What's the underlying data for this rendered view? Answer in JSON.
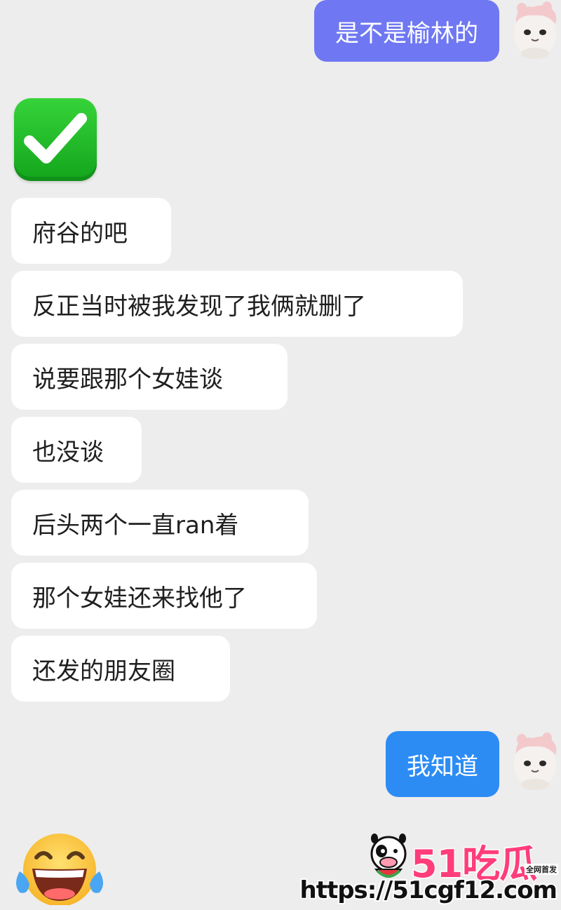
{
  "messages": [
    {
      "id": "m1",
      "sender": "self",
      "text": "是不是榆林的",
      "style": "purple"
    },
    {
      "id": "m2",
      "sender": "other",
      "emoji": "check-mark-emoji"
    },
    {
      "id": "m3",
      "sender": "other",
      "text": "府谷的吧"
    },
    {
      "id": "m4",
      "sender": "other",
      "text": "反正当时被我发现了我俩就删了"
    },
    {
      "id": "m5",
      "sender": "other",
      "text": "说要跟那个女娃谈"
    },
    {
      "id": "m6",
      "sender": "other",
      "text": "也没谈"
    },
    {
      "id": "m7",
      "sender": "other",
      "text": "后头两个一直ran着"
    },
    {
      "id": "m8",
      "sender": "other",
      "text": "那个女娃还来找他了"
    },
    {
      "id": "m9",
      "sender": "other",
      "text": "还发的朋友圈"
    },
    {
      "id": "m10",
      "sender": "self",
      "text": "我知道",
      "style": "blue"
    },
    {
      "id": "m11",
      "sender": "other",
      "emoji": "laughing-tears-emoji"
    }
  ],
  "watermark": {
    "brand": "51吃瓜",
    "tag": "全网首发",
    "url": "https://51cgf12.com"
  },
  "colors": {
    "background": "#ededed",
    "bubble_self_purple": "#6f78f2",
    "bubble_self_blue": "#2c8cf4",
    "bubble_other": "#ffffff"
  }
}
